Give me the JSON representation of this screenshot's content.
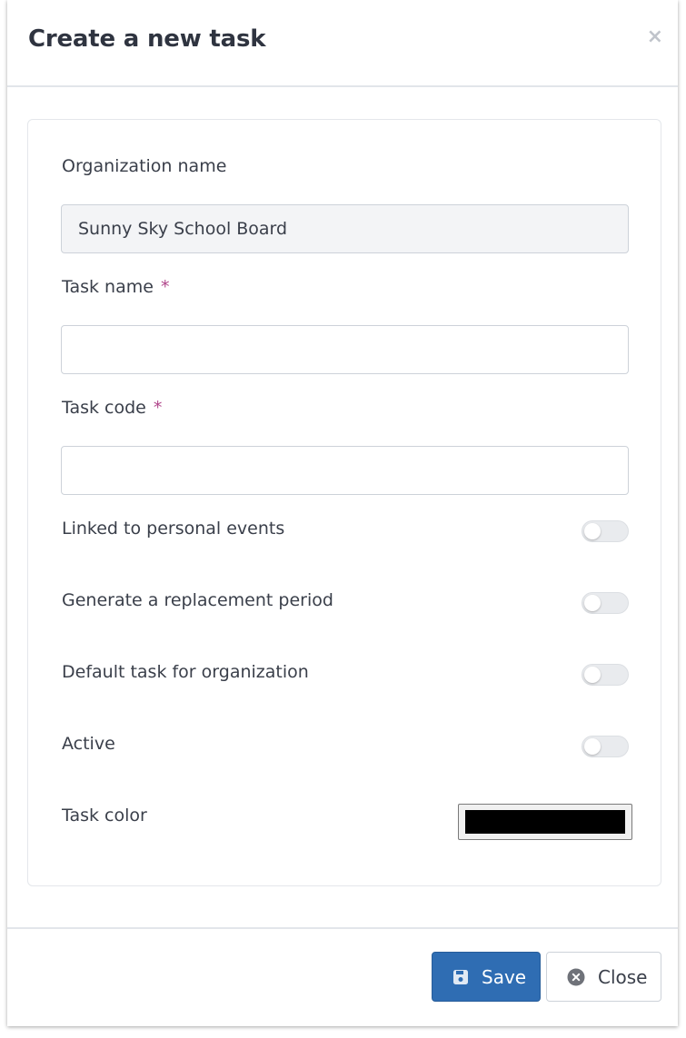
{
  "dialog": {
    "title": "Create a new task",
    "close_icon": "×"
  },
  "form": {
    "organization": {
      "label": "Organization name",
      "value": "Sunny Sky School Board"
    },
    "task_name": {
      "label": "Task name",
      "required_mark": "*",
      "value": "",
      "placeholder": ""
    },
    "task_code": {
      "label": "Task code",
      "required_mark": "*",
      "value": "",
      "placeholder": ""
    },
    "toggles": [
      {
        "label": "Linked to personal events",
        "checked": false
      },
      {
        "label": "Generate a replacement period",
        "checked": false
      },
      {
        "label": "Default task for organization",
        "checked": false
      },
      {
        "label": "Active",
        "checked": false
      }
    ],
    "task_color": {
      "label": "Task color",
      "value": "#000000"
    }
  },
  "footer": {
    "save_label": "Save",
    "save_icon": "floppy-disk-icon",
    "close_label": "Close",
    "close_icon": "circle-x-icon"
  },
  "colors": {
    "primary": "#2f6db3",
    "required": "#b0458a"
  }
}
